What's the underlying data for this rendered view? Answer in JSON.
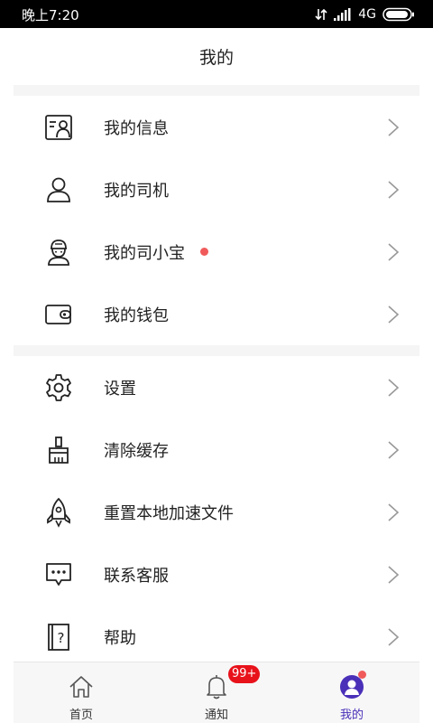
{
  "status_bar": {
    "time": "晚上7:20",
    "network": "4G"
  },
  "header": {
    "title": "我的"
  },
  "menu": {
    "group1": [
      {
        "label": "我的信息",
        "icon": "profile-card-icon"
      },
      {
        "label": "我的司机",
        "icon": "driver-person-icon"
      },
      {
        "label": "我的司小宝",
        "icon": "assistant-character-icon",
        "has_dot": true
      },
      {
        "label": "我的钱包",
        "icon": "wallet-icon"
      }
    ],
    "group2": [
      {
        "label": "设置",
        "icon": "gear-icon"
      },
      {
        "label": "清除缓存",
        "icon": "broom-icon"
      },
      {
        "label": "重置本地加速文件",
        "icon": "rocket-icon"
      },
      {
        "label": "联系客服",
        "icon": "chat-bubble-icon"
      },
      {
        "label": "帮助",
        "icon": "help-book-icon"
      }
    ]
  },
  "tabs": [
    {
      "label": "首页",
      "icon": "home-icon"
    },
    {
      "label": "通知",
      "icon": "bell-icon",
      "badge": "99+"
    },
    {
      "label": "我的",
      "icon": "user-avatar-icon",
      "active": true
    }
  ],
  "colors": {
    "accent": "#4a2fb8",
    "badge": "#e8121b",
    "dot": "#f05a5a"
  }
}
